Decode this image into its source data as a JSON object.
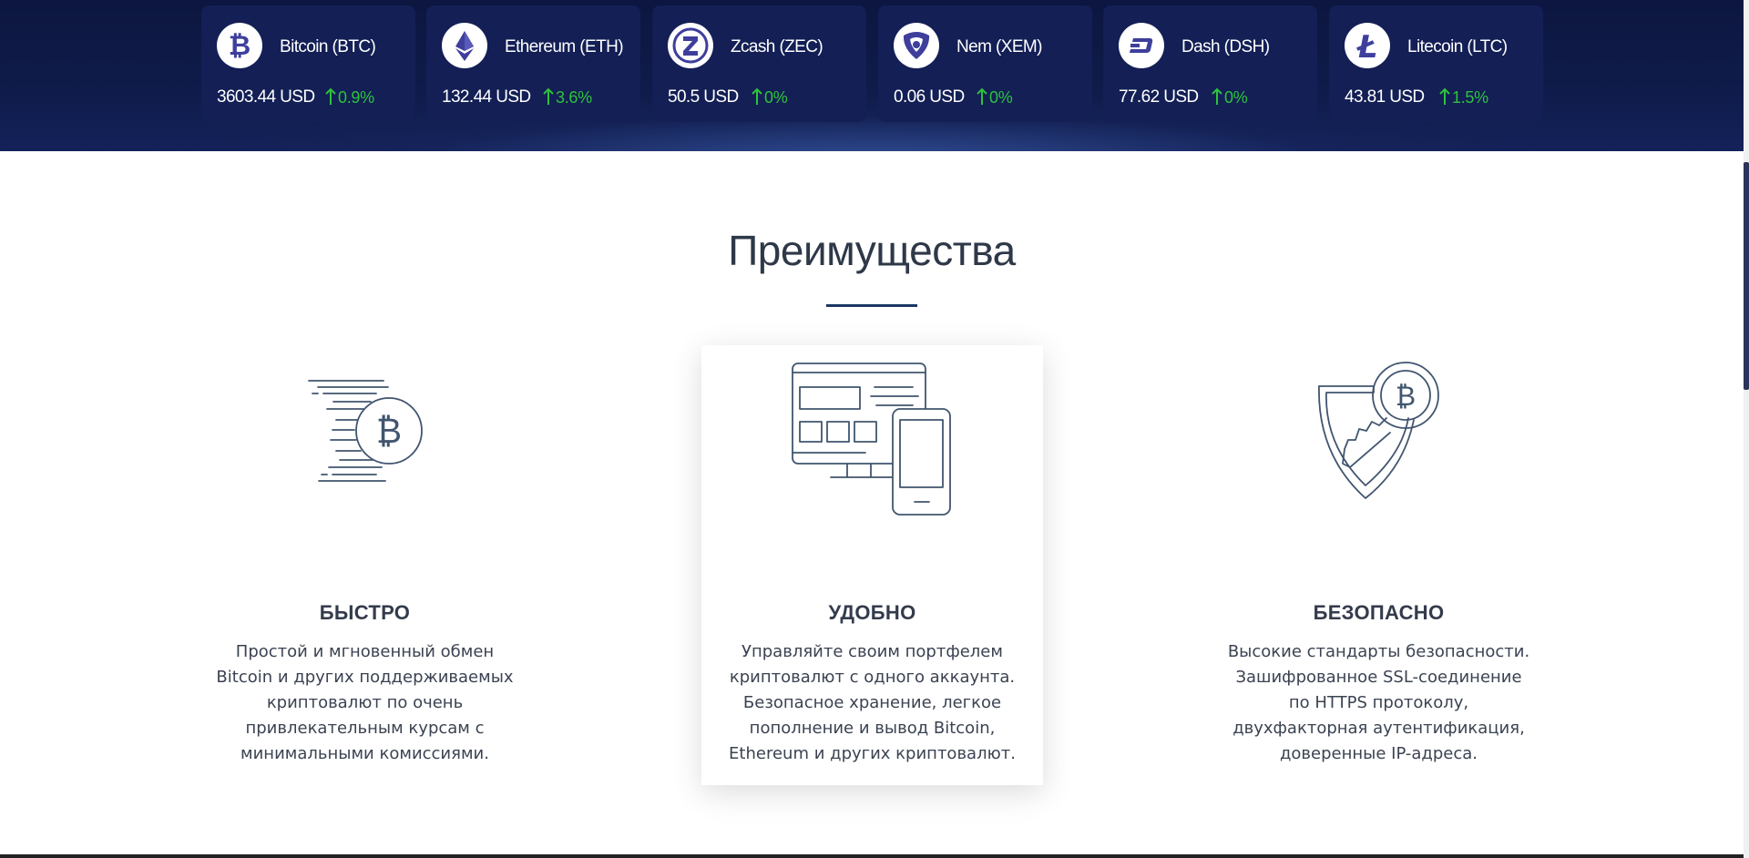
{
  "ticker": [
    {
      "name": "Bitcoin",
      "symbol": "(BTC)",
      "price": "3603.44 USD",
      "change": "0.9%",
      "icon": "bitcoin-icon"
    },
    {
      "name": "Ethereum",
      "symbol": "(ETH)",
      "price": "132.44 USD",
      "change": "3.6%",
      "icon": "ethereum-icon"
    },
    {
      "name": "Zcash",
      "symbol": "(ZEC)",
      "price": "50.5 USD",
      "change": "0%",
      "icon": "zcash-icon"
    },
    {
      "name": "Nem",
      "symbol": "(XEM)",
      "price": "0.06 USD",
      "change": "0%",
      "icon": "nem-icon"
    },
    {
      "name": "Dash",
      "symbol": "(DSH)",
      "price": "77.62 USD",
      "change": "0%",
      "icon": "dash-icon"
    },
    {
      "name": "Litecoin",
      "symbol": "(LTC)",
      "price": "43.81 USD",
      "change": "1.5%",
      "icon": "litecoin-icon"
    }
  ],
  "colors": {
    "band": "#0f1b4a",
    "card": "#131f55",
    "up": "#2ec23c",
    "accent": "#1b3663",
    "coin": "#3e3f9c"
  },
  "advantages": {
    "title": "Преимущества",
    "features": [
      {
        "title": "БЫСТРО",
        "text": "Простой и мгновенный обмен Bitcoin и других поддерживаемых криптовалют по очень привлекательным курсам с минимальными комиссиями.",
        "icon": "fast-bitcoin-icon"
      },
      {
        "title": "УДОБНО",
        "text": "Управляйте своим портфелем криптовалют с одного аккаунта. Безопасное хранение, легкое пополнение и вывод Bitcoin, Ethereum и других криптовалют.",
        "icon": "devices-icon"
      },
      {
        "title": "БЕЗОПАСНО",
        "text": "Высокие стандарты безопасности. Зашифрованное SSL-соединение по HTTPS протоколу, двухфакторная аутентификация, доверенные IP-адреса.",
        "icon": "shield-key-icon"
      }
    ]
  }
}
